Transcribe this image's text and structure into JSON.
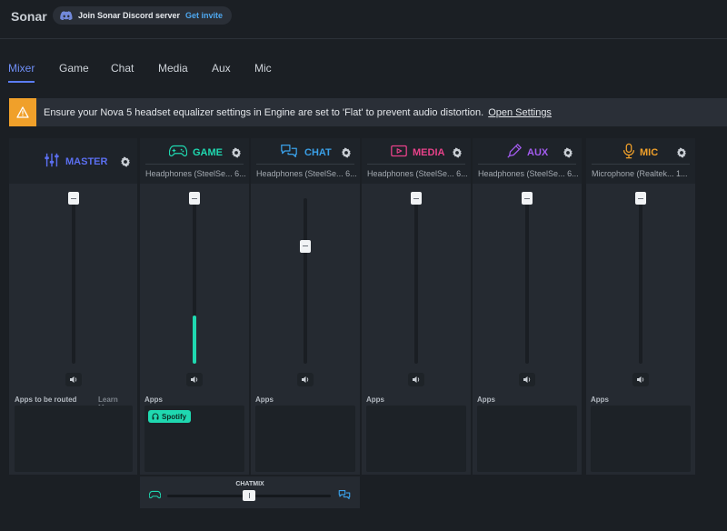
{
  "app": {
    "title": "Sonar"
  },
  "discord": {
    "join_text": "Join Sonar Discord server",
    "invite_link": "Get invite"
  },
  "tabs": [
    {
      "label": "Mixer",
      "active": true
    },
    {
      "label": "Game"
    },
    {
      "label": "Chat"
    },
    {
      "label": "Media"
    },
    {
      "label": "Aux"
    },
    {
      "label": "Mic"
    }
  ],
  "warning": {
    "text": "Ensure your Nova 5 headset equalizer settings in Engine are set to 'Flat' to prevent audio distortion.",
    "link": "Open Settings",
    "color": "#f0a02a"
  },
  "channels": {
    "master": {
      "name": "MASTER",
      "color": "#5b6ff0",
      "level": 1.0,
      "apps_label": "Apps to be routed",
      "learn_more": "Learn More",
      "icon": "sliders-icon"
    },
    "game": {
      "name": "GAME",
      "color": "#1fd8b0",
      "device": "Headphones (SteelSe... 6...",
      "level": 1.0,
      "meter": 0.29,
      "apps_label": "Apps",
      "apps": [
        {
          "name": "Spotify",
          "icon": "headphones-icon"
        }
      ],
      "icon": "gamepad-icon"
    },
    "chat": {
      "name": "CHAT",
      "color": "#3aa0e8",
      "device": "Headphones (SteelSe... 6...",
      "level": 0.71,
      "apps_label": "Apps",
      "icon": "chat-bubbles-icon"
    },
    "media": {
      "name": "MEDIA",
      "color": "#e8428a",
      "device": "Headphones (SteelSe... 6...",
      "level": 1.0,
      "apps_label": "Apps",
      "icon": "play-icon"
    },
    "aux": {
      "name": "AUX",
      "color": "#a45cf0",
      "device": "Headphones (SteelSe... 6...",
      "level": 1.0,
      "apps_label": "Apps",
      "icon": "pen-icon"
    },
    "mic": {
      "name": "MIC",
      "color": "#f0a02a",
      "device": "Microphone (Realtek... 1...",
      "level": 1.0,
      "apps_label": "Apps",
      "icon": "microphone-icon"
    }
  },
  "chatmix": {
    "label": "CHATMIX",
    "balance": 0.5
  }
}
